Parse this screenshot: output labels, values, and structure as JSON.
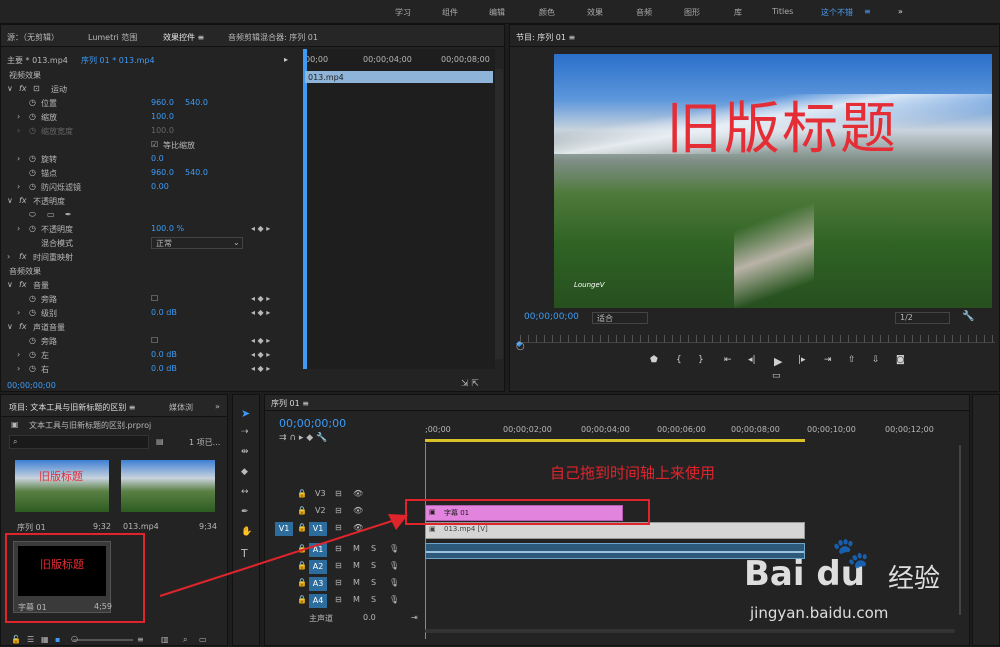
{
  "workspace": {
    "items": [
      "学习",
      "组件",
      "编辑",
      "颜色",
      "效果",
      "音频",
      "图形",
      "库",
      "Titles",
      "这个不错",
      "≡"
    ],
    "more": "»"
  },
  "effect_panel": {
    "tabs": [
      "源：（无剪辑）",
      "Lumetri 范围",
      "效果控件 ≡",
      "音频剪辑混合器: 序列 01"
    ],
    "master": "主要 * 013.mp4",
    "sequence": "序列 01 * 013.mp4",
    "ruler": [
      "00;00",
      "00;00;04;00",
      "00;00;08;00"
    ],
    "clip": "013.mp4",
    "video_effects": "视频效果",
    "motion": "运动",
    "position": {
      "label": "位置",
      "x": "960.0",
      "y": "540.0"
    },
    "scale": {
      "label": "缩放",
      "value": "100.0"
    },
    "scale_width": {
      "label": "缩放宽度",
      "value": "100.0"
    },
    "uniform": "等比缩放",
    "rotation": {
      "label": "旋转",
      "value": "0.0"
    },
    "anchor": {
      "label": "锚点",
      "x": "960.0",
      "y": "540.0"
    },
    "flicker": {
      "label": "防闪烁滤镜",
      "value": "0.00"
    },
    "opacity_group": "不透明度",
    "opacity": {
      "label": "不透明度",
      "value": "100.0 %"
    },
    "blend": {
      "label": "混合模式",
      "value": "正常"
    },
    "remap": "时间重映射",
    "audio_effects": "音频效果",
    "volume": "音量",
    "bypass1": "旁路",
    "level": {
      "label": "级别",
      "value": "0.0 dB"
    },
    "channel": "声道音量",
    "bypass2": "旁路",
    "left": {
      "label": "左",
      "value": "0.0 dB"
    },
    "right": {
      "label": "右",
      "value": "0.0 dB"
    },
    "timecode": "00;00;00;00"
  },
  "program": {
    "title": "节目: 序列 01 ≡",
    "overlay_title": "旧版标题",
    "watermark": "LoungeV",
    "timecode": "00;00;00;00",
    "fit": "适合",
    "quality": "1/2"
  },
  "project": {
    "tab": "项目: 文本工具与旧新标题的区别 ≡",
    "tab2": "媒体浏",
    "file": "文本工具与旧新标题的区别.prproj",
    "count": "1 项已...",
    "items": [
      {
        "name": "序列 01",
        "dur": "9;32"
      },
      {
        "name": "013.mp4",
        "dur": "9;34"
      },
      {
        "name": "字幕 01",
        "dur": "4;59"
      }
    ],
    "thumb_title": "旧版标题"
  },
  "timeline": {
    "tab": "序列 01 ≡",
    "timecode": "00;00;00;00",
    "ruler": [
      ";00;00",
      "00;00;02;00",
      "00;00;04;00",
      "00;00;06;00",
      "00;00;08;00",
      "00;00;10;00",
      "00;00;12;00"
    ],
    "video_tracks": [
      "V3",
      "V2",
      "V1"
    ],
    "src_v": "V1",
    "audio_tracks": [
      "A1",
      "A2",
      "A3",
      "A4"
    ],
    "master": "主声道",
    "master_val": "0.0",
    "clip_title": "字幕 01",
    "clip_video": "013.mp4 [V]",
    "annotation": "自己拖到时间轴上来使用"
  },
  "watermark_logo": {
    "brand": "Bai  du",
    "cn": "经验",
    "url": "jingyan.baidu.com"
  }
}
